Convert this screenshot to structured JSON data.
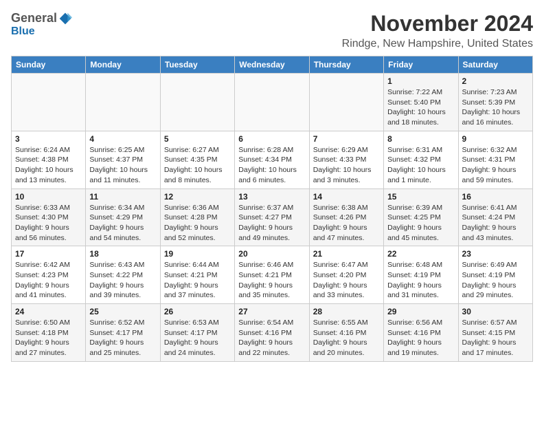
{
  "header": {
    "logo_general": "General",
    "logo_blue": "Blue",
    "month_title": "November 2024",
    "location": "Rindge, New Hampshire, United States"
  },
  "weekdays": [
    "Sunday",
    "Monday",
    "Tuesday",
    "Wednesday",
    "Thursday",
    "Friday",
    "Saturday"
  ],
  "weeks": [
    [
      {
        "day": "",
        "info": ""
      },
      {
        "day": "",
        "info": ""
      },
      {
        "day": "",
        "info": ""
      },
      {
        "day": "",
        "info": ""
      },
      {
        "day": "",
        "info": ""
      },
      {
        "day": "1",
        "info": "Sunrise: 7:22 AM\nSunset: 5:40 PM\nDaylight: 10 hours and 18 minutes."
      },
      {
        "day": "2",
        "info": "Sunrise: 7:23 AM\nSunset: 5:39 PM\nDaylight: 10 hours and 16 minutes."
      }
    ],
    [
      {
        "day": "3",
        "info": "Sunrise: 6:24 AM\nSunset: 4:38 PM\nDaylight: 10 hours and 13 minutes."
      },
      {
        "day": "4",
        "info": "Sunrise: 6:25 AM\nSunset: 4:37 PM\nDaylight: 10 hours and 11 minutes."
      },
      {
        "day": "5",
        "info": "Sunrise: 6:27 AM\nSunset: 4:35 PM\nDaylight: 10 hours and 8 minutes."
      },
      {
        "day": "6",
        "info": "Sunrise: 6:28 AM\nSunset: 4:34 PM\nDaylight: 10 hours and 6 minutes."
      },
      {
        "day": "7",
        "info": "Sunrise: 6:29 AM\nSunset: 4:33 PM\nDaylight: 10 hours and 3 minutes."
      },
      {
        "day": "8",
        "info": "Sunrise: 6:31 AM\nSunset: 4:32 PM\nDaylight: 10 hours and 1 minute."
      },
      {
        "day": "9",
        "info": "Sunrise: 6:32 AM\nSunset: 4:31 PM\nDaylight: 9 hours and 59 minutes."
      }
    ],
    [
      {
        "day": "10",
        "info": "Sunrise: 6:33 AM\nSunset: 4:30 PM\nDaylight: 9 hours and 56 minutes."
      },
      {
        "day": "11",
        "info": "Sunrise: 6:34 AM\nSunset: 4:29 PM\nDaylight: 9 hours and 54 minutes."
      },
      {
        "day": "12",
        "info": "Sunrise: 6:36 AM\nSunset: 4:28 PM\nDaylight: 9 hours and 52 minutes."
      },
      {
        "day": "13",
        "info": "Sunrise: 6:37 AM\nSunset: 4:27 PM\nDaylight: 9 hours and 49 minutes."
      },
      {
        "day": "14",
        "info": "Sunrise: 6:38 AM\nSunset: 4:26 PM\nDaylight: 9 hours and 47 minutes."
      },
      {
        "day": "15",
        "info": "Sunrise: 6:39 AM\nSunset: 4:25 PM\nDaylight: 9 hours and 45 minutes."
      },
      {
        "day": "16",
        "info": "Sunrise: 6:41 AM\nSunset: 4:24 PM\nDaylight: 9 hours and 43 minutes."
      }
    ],
    [
      {
        "day": "17",
        "info": "Sunrise: 6:42 AM\nSunset: 4:23 PM\nDaylight: 9 hours and 41 minutes."
      },
      {
        "day": "18",
        "info": "Sunrise: 6:43 AM\nSunset: 4:22 PM\nDaylight: 9 hours and 39 minutes."
      },
      {
        "day": "19",
        "info": "Sunrise: 6:44 AM\nSunset: 4:21 PM\nDaylight: 9 hours and 37 minutes."
      },
      {
        "day": "20",
        "info": "Sunrise: 6:46 AM\nSunset: 4:21 PM\nDaylight: 9 hours and 35 minutes."
      },
      {
        "day": "21",
        "info": "Sunrise: 6:47 AM\nSunset: 4:20 PM\nDaylight: 9 hours and 33 minutes."
      },
      {
        "day": "22",
        "info": "Sunrise: 6:48 AM\nSunset: 4:19 PM\nDaylight: 9 hours and 31 minutes."
      },
      {
        "day": "23",
        "info": "Sunrise: 6:49 AM\nSunset: 4:19 PM\nDaylight: 9 hours and 29 minutes."
      }
    ],
    [
      {
        "day": "24",
        "info": "Sunrise: 6:50 AM\nSunset: 4:18 PM\nDaylight: 9 hours and 27 minutes."
      },
      {
        "day": "25",
        "info": "Sunrise: 6:52 AM\nSunset: 4:17 PM\nDaylight: 9 hours and 25 minutes."
      },
      {
        "day": "26",
        "info": "Sunrise: 6:53 AM\nSunset: 4:17 PM\nDaylight: 9 hours and 24 minutes."
      },
      {
        "day": "27",
        "info": "Sunrise: 6:54 AM\nSunset: 4:16 PM\nDaylight: 9 hours and 22 minutes."
      },
      {
        "day": "28",
        "info": "Sunrise: 6:55 AM\nSunset: 4:16 PM\nDaylight: 9 hours and 20 minutes."
      },
      {
        "day": "29",
        "info": "Sunrise: 6:56 AM\nSunset: 4:16 PM\nDaylight: 9 hours and 19 minutes."
      },
      {
        "day": "30",
        "info": "Sunrise: 6:57 AM\nSunset: 4:15 PM\nDaylight: 9 hours and 17 minutes."
      }
    ]
  ]
}
